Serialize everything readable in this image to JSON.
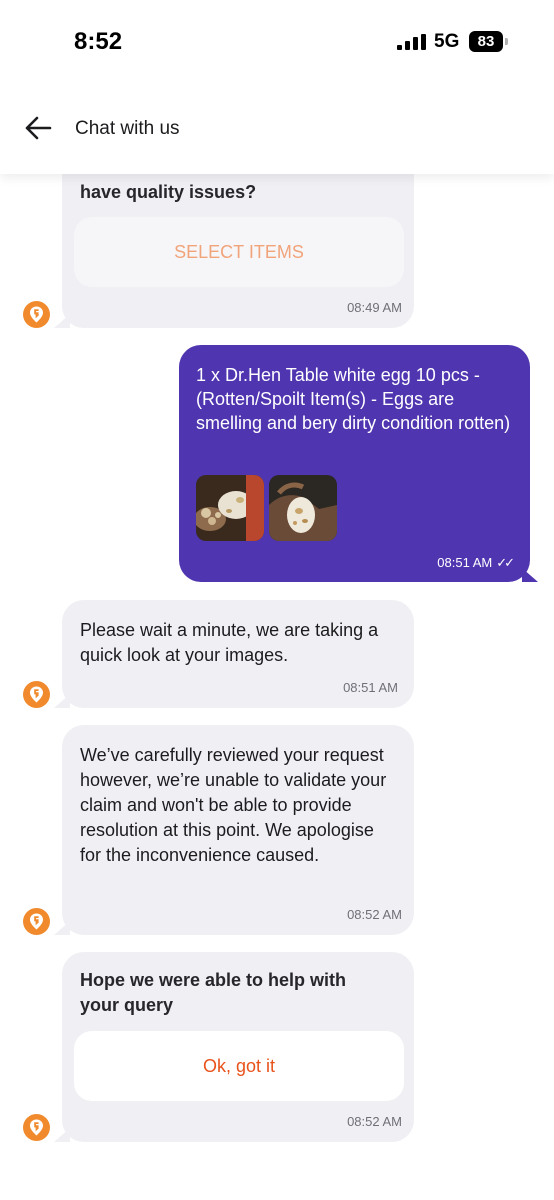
{
  "status_bar": {
    "time": "8:52",
    "network": "5G",
    "battery": "83"
  },
  "header": {
    "title": "Chat with us"
  },
  "messages": {
    "m1": {
      "text": "have quality issues?",
      "button": "SELECT ITEMS",
      "time": "08:49 AM"
    },
    "m2": {
      "text": "1 x Dr.Hen Table white egg 10 pcs - (Rotten/Spoilt Item(s) - Eggs are smelling and bery dirty condition rotten)",
      "time": "08:51 AM",
      "ticks": "✓✓"
    },
    "m3": {
      "text": "Please wait a minute, we are taking a quick look at your images.",
      "time": "08:51 AM"
    },
    "m4": {
      "text": "We’ve carefully reviewed your request however, we’re unable to validate your claim and won't be able to provide resolution at this point. We apologise for the inconvenience caused.",
      "time": "08:52 AM"
    },
    "m5": {
      "text": "Hope we were able to help with your query",
      "button": "Ok, got it",
      "time": "08:52 AM"
    }
  },
  "colors": {
    "brand": "#f08a2d",
    "user_bubble": "#4f35b0",
    "agent_bubble": "#f0f0f4",
    "action_text": "#e8531b"
  },
  "icons": {
    "back": "arrow-left-icon",
    "avatar": "swiggy-logo-icon",
    "read": "double-check-icon"
  }
}
